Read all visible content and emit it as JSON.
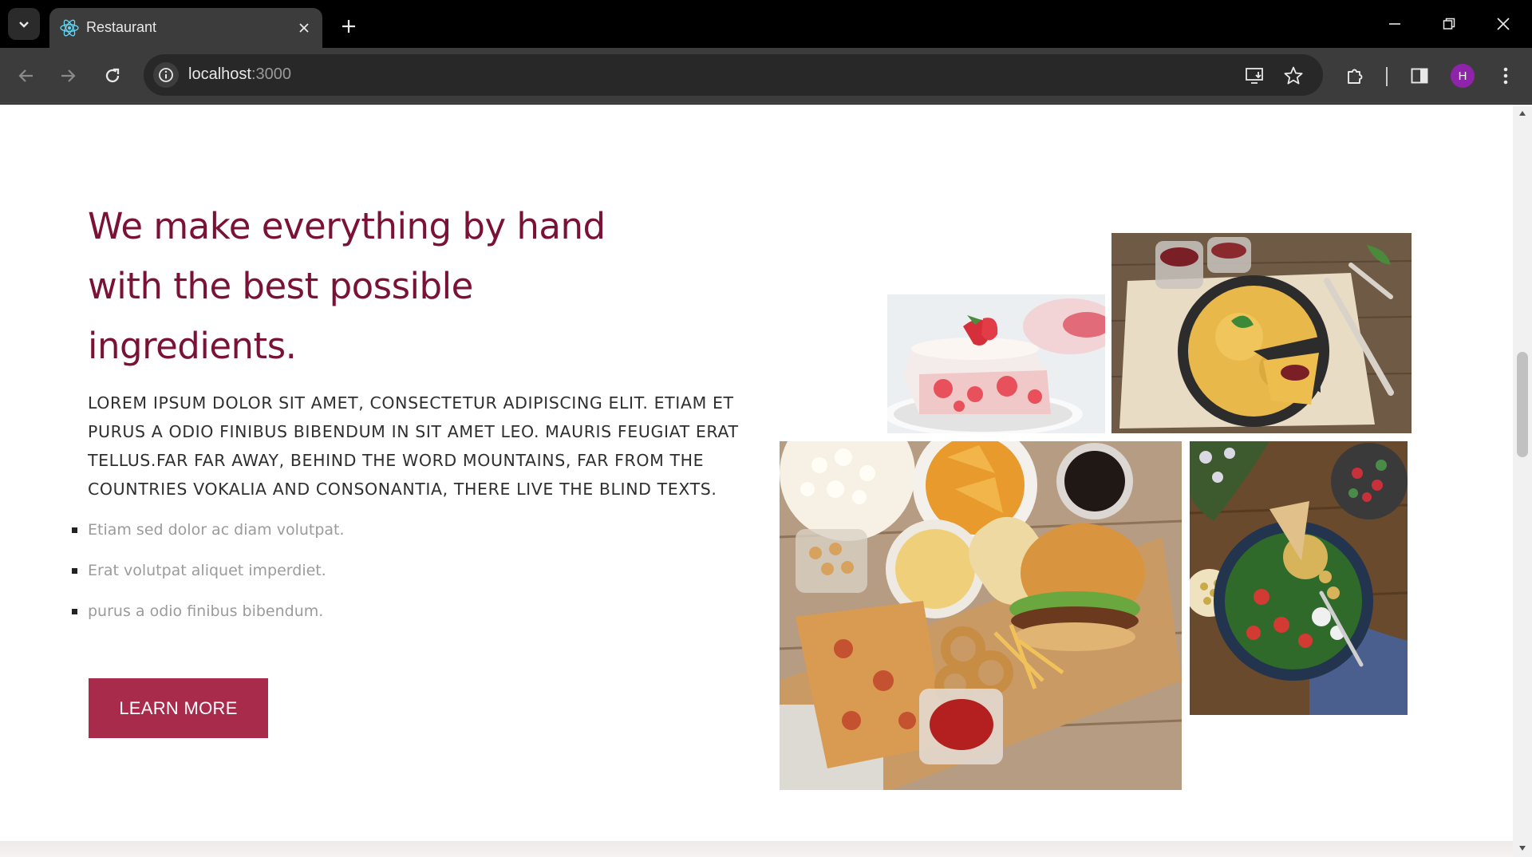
{
  "browser": {
    "tab": {
      "title": "Restaurant",
      "favicon": "react-icon"
    },
    "address": {
      "host": "localhost",
      "port": ":3000"
    },
    "profile_initial": "H",
    "icons": [
      "tab-list-icon",
      "close-icon",
      "new-tab-icon",
      "minimize-icon",
      "restore-icon",
      "window-close-icon",
      "back-icon",
      "forward-icon",
      "reload-icon",
      "site-info-icon",
      "install-app-icon",
      "bookmark-star-icon",
      "extensions-icon",
      "side-panel-icon",
      "menu-dots-icon"
    ]
  },
  "about": {
    "heading": "We make everything by hand with the best possible ingredients.",
    "lead": "Lorem ipsum dolor sit amet, consectetur adipiscing elit. Etiam et purus a odio finibus bibendum in sit amet leo. Mauris feugiat erat tellus.Far far away, behind the word mountains, far from the countries Vokalia and Consonantia, there live the blind texts.",
    "features": [
      "Etiam sed dolor ac diam volutpat.",
      "Erat volutpat aliquet imperdiet.",
      "purus a odio finibus bibendum."
    ],
    "cta_label": "LEARN MORE"
  },
  "colors": {
    "heading": "#7a1236",
    "button": "#a82b4c",
    "chrome_bg": "#3c3c3c",
    "avatar": "#8e24aa"
  }
}
